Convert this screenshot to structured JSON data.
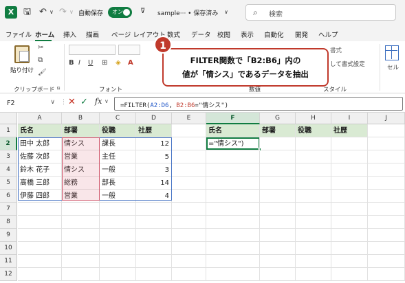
{
  "titlebar": {
    "autosave_label": "自動保存",
    "autosave_state": "オン",
    "filename": "sample··· • 保存済み",
    "filename_dropdown": "∨",
    "search_placeholder": "検索"
  },
  "tabs": [
    {
      "label": "ファイル"
    },
    {
      "label": "ホーム",
      "active": true
    },
    {
      "label": "挿入"
    },
    {
      "label": "描画"
    },
    {
      "label": "ページ レイアウト"
    },
    {
      "label": "数式"
    },
    {
      "label": "データ"
    },
    {
      "label": "校閲"
    },
    {
      "label": "表示"
    },
    {
      "label": "自動化"
    },
    {
      "label": "開発"
    },
    {
      "label": "ヘルプ"
    }
  ],
  "ribbon": {
    "paste_label": "貼り付け",
    "groups": {
      "clipboard": "クリップボード",
      "font": "フォント",
      "numeric": "数値",
      "style": "スタイル"
    },
    "partial_labels": {
      "conditional": "書式",
      "table_format": "して書式設定",
      "cell": "セル"
    }
  },
  "formula_bar": {
    "name_box": "F2",
    "fx_label": "fx",
    "formula_prefix": "=FILTER(",
    "ref1": "A2:D6",
    "mid": ", ",
    "ref2": "B2:B6",
    "formula_suffix": "=\"情シス\")"
  },
  "sheet": {
    "columns": [
      "A",
      "B",
      "C",
      "D",
      "E",
      "F",
      "G",
      "H",
      "I",
      "J"
    ],
    "rows": [
      "1",
      "2",
      "3",
      "4",
      "5",
      "6",
      "7",
      "8",
      "9",
      "10",
      "11",
      "12"
    ],
    "headers": [
      "氏名",
      "部署",
      "役職",
      "社歴"
    ],
    "data": [
      [
        "田中 太郎",
        "情シス",
        "課長",
        "12"
      ],
      [
        "佐藤 次郎",
        "営業",
        "主任",
        "5"
      ],
      [
        "鈴木 花子",
        "情シス",
        "一般",
        "3"
      ],
      [
        "高橋 三郎",
        "総務",
        "部長",
        "14"
      ],
      [
        "伊藤 四郎",
        "営業",
        "一般",
        "4"
      ]
    ],
    "output_headers": [
      "氏名",
      "部署",
      "役職",
      "社歴"
    ],
    "editing_cell_text": "=\"情シス\")"
  },
  "callout": {
    "number": "1",
    "line1": "FILTER関数で「B2:B6」内の",
    "line2": "値が「情シス」であるデータを抽出"
  },
  "colors": {
    "excel_green": "#107c41",
    "callout_red": "#c0392b",
    "range_blue": "#4472c4",
    "range_red": "#d05a6e",
    "header_fill": "#d9ead3"
  }
}
